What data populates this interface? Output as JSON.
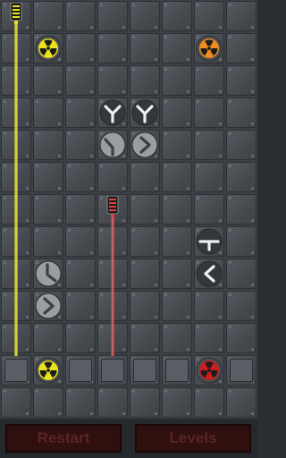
{
  "game": {
    "grid_cols": 8,
    "grid_rows": 13,
    "buttons": {
      "restart": "Restart",
      "levels": "Levels"
    },
    "colors": {
      "yellow": "#e8e31c",
      "red": "#e53f3f",
      "orange": "#ef8b22",
      "dark_red": "#c81e1e",
      "mirror_light": "#eeeeee",
      "mirror_dark": "#3c3f43",
      "button_bg": "#300f0f",
      "button_text": "#5a2424"
    },
    "emitters": [
      {
        "color": "yellow",
        "col": 0,
        "row": 0,
        "direction": "down"
      },
      {
        "color": "red",
        "col": 3,
        "row": 6,
        "direction": "down"
      }
    ],
    "beams": [
      {
        "color": "yellow",
        "col": 0,
        "row_start": 0,
        "row_end": 11
      },
      {
        "color": "red",
        "col": 3,
        "row_start": 6,
        "row_end": 11
      }
    ],
    "targets": [
      {
        "color": "yellow",
        "col": 1,
        "row": 1,
        "icon": "radiation-icon"
      },
      {
        "color": "orange",
        "col": 6,
        "row": 1,
        "icon": "radiation-icon"
      },
      {
        "color": "yellow",
        "col": 1,
        "row": 11,
        "icon": "radiation-icon"
      },
      {
        "color": "dark_red",
        "col": 6,
        "row": 11,
        "icon": "radiation-icon"
      }
    ],
    "mirrors": [
      {
        "type": "splitter",
        "col": 3,
        "row": 3,
        "style": "light",
        "icon": "splitter-icon"
      },
      {
        "type": "splitter",
        "col": 4,
        "row": 3,
        "style": "light",
        "icon": "splitter-icon"
      },
      {
        "type": "bend",
        "col": 3,
        "row": 4,
        "style": "dark",
        "icon": "mirror-bend-icon"
      },
      {
        "type": "chevron-right",
        "col": 4,
        "row": 4,
        "style": "dark",
        "icon": "chevron-right-icon"
      },
      {
        "type": "tee",
        "col": 6,
        "row": 7,
        "style": "light",
        "icon": "tee-icon"
      },
      {
        "type": "chevron-left",
        "col": 6,
        "row": 8,
        "style": "light",
        "icon": "chevron-left-icon"
      },
      {
        "type": "angle",
        "col": 1,
        "row": 8,
        "style": "dark",
        "icon": "angle-mirror-icon"
      },
      {
        "type": "chevron-right",
        "col": 1,
        "row": 9,
        "style": "dark",
        "icon": "chevron-right-icon"
      }
    ],
    "slot_row": 11,
    "slot_cols": [
      0,
      2,
      3,
      4,
      5,
      7
    ]
  }
}
